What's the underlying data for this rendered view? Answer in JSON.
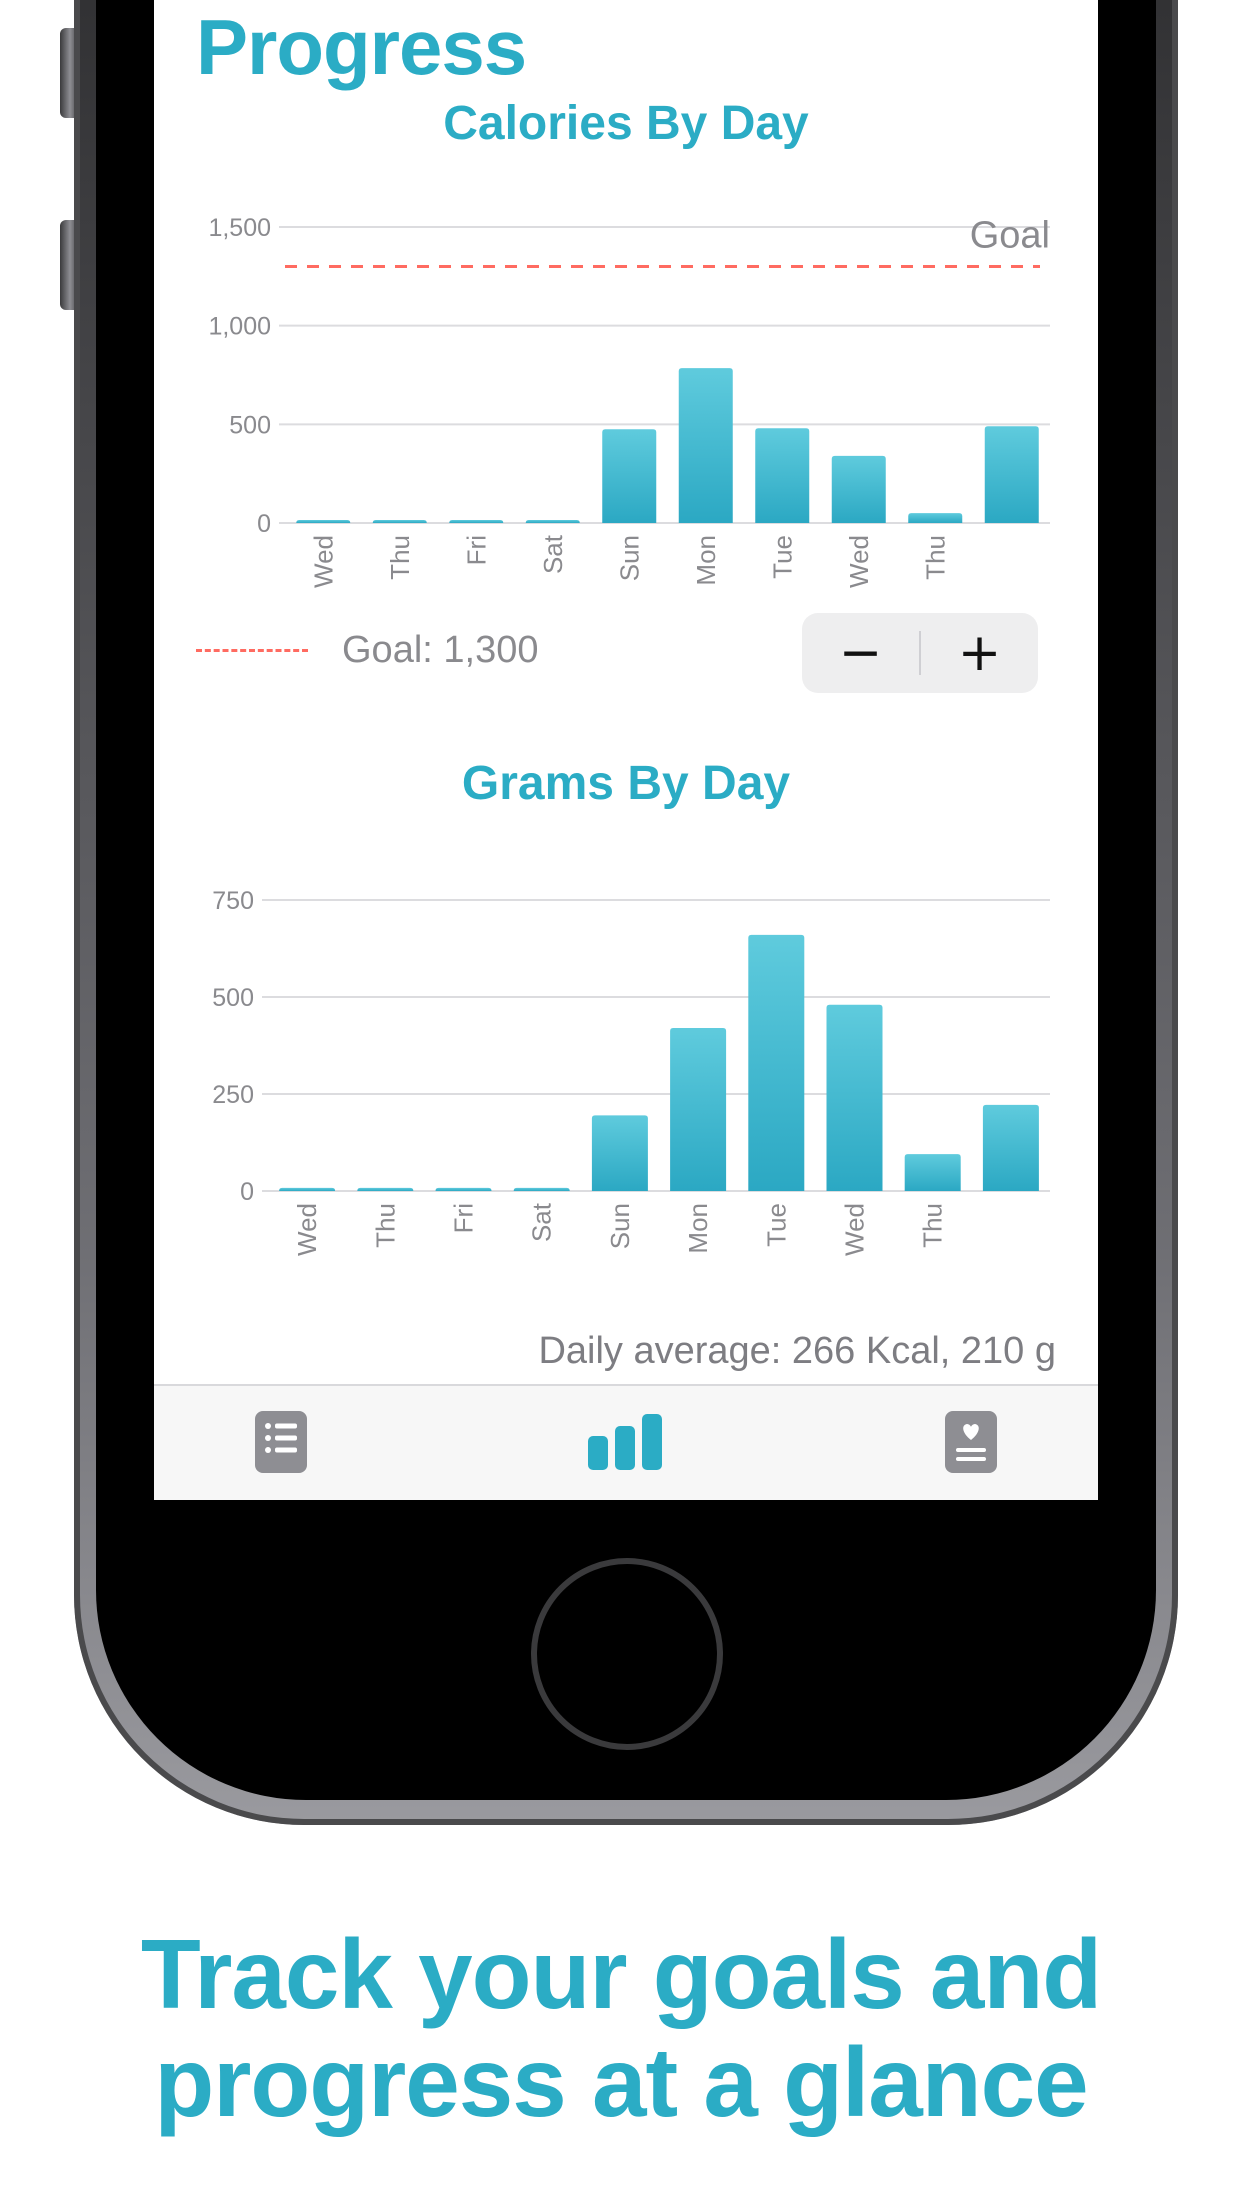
{
  "colors": {
    "accent": "#2bacc5",
    "bar_top": "#5fcbdd",
    "bar_bottom": "#2ba8c3",
    "goal_line": "#ff6b61",
    "axis_text": "#8a8a8e",
    "tab_inactive": "#8e8e93"
  },
  "screen": {
    "title": "Progress",
    "calories_chart": {
      "goal_annotation": "Goal",
      "goal_legend": "Goal: 1,300",
      "stepper": {
        "minus_label": "−",
        "plus_label": "+"
      }
    },
    "daily_average": "Daily average: 266 Kcal, 210 g"
  },
  "tab_bar": {
    "items": [
      {
        "icon": "list-icon",
        "active": false
      },
      {
        "icon": "bar-chart-icon",
        "active": true
      },
      {
        "icon": "health-card-icon",
        "active": false
      }
    ]
  },
  "marketing": {
    "line1": "Track your goals and",
    "line2": "progress at a glance"
  },
  "chart_data": [
    {
      "type": "bar",
      "title": "Calories By Day",
      "categories": [
        "Wed",
        "Thu",
        "Fri",
        "Sat",
        "Sun",
        "Mon",
        "Tue",
        "Wed",
        "Thu",
        ""
      ],
      "values": [
        10,
        10,
        10,
        10,
        475,
        785,
        480,
        340,
        50,
        490
      ],
      "ylim": [
        0,
        1500
      ],
      "yticks": [
        0,
        500,
        1000,
        1500
      ],
      "ytick_labels": [
        "0",
        "500",
        "1,000",
        "1,500"
      ],
      "goal": 1300,
      "grid": true
    },
    {
      "type": "bar",
      "title": "Grams By Day",
      "categories": [
        "Wed",
        "Thu",
        "Fri",
        "Sat",
        "Sun",
        "Mon",
        "Tue",
        "Wed",
        "Thu",
        ""
      ],
      "values": [
        8,
        8,
        8,
        8,
        195,
        420,
        660,
        480,
        95,
        222
      ],
      "ylim": [
        0,
        750
      ],
      "yticks": [
        0,
        250,
        500,
        750
      ],
      "ytick_labels": [
        "0",
        "250",
        "500",
        "750"
      ],
      "grid": true
    }
  ]
}
